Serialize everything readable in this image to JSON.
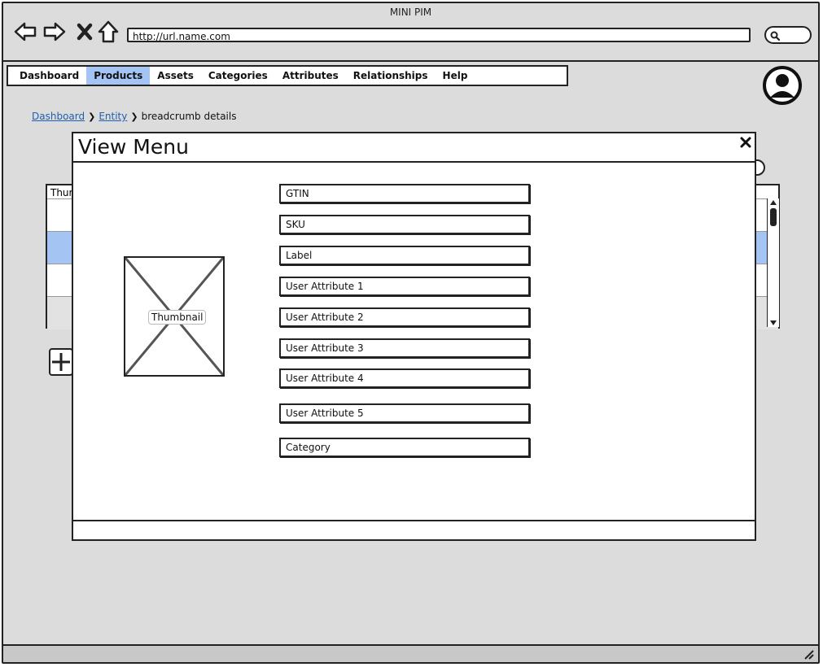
{
  "window": {
    "title": "MINI PIM"
  },
  "toolbar": {
    "url": "http://url.name.com"
  },
  "menu": {
    "items": [
      {
        "label": "Dashboard"
      },
      {
        "label": "Products"
      },
      {
        "label": "Assets"
      },
      {
        "label": "Categories"
      },
      {
        "label": "Attributes"
      },
      {
        "label": "Relationships"
      },
      {
        "label": "Help"
      }
    ],
    "active": "Products"
  },
  "breadcrumb": {
    "items": [
      {
        "label": "Dashboard"
      },
      {
        "label": "Entity"
      },
      {
        "label": "breadcrumb details"
      }
    ]
  },
  "background_table": {
    "header_partial": "Thur"
  },
  "modal": {
    "title": "View Menu",
    "close_icon": "close-icon",
    "thumbnail_label": "Thumbnail",
    "fields": [
      {
        "label": "GTIN"
      },
      {
        "label": "SKU"
      },
      {
        "label": "Label"
      },
      {
        "label": "User Attribute 1"
      },
      {
        "label": "User Attribute 2"
      },
      {
        "label": "User Attribute 3"
      },
      {
        "label": "User Attribute 4"
      },
      {
        "label": "User Attribute 5"
      },
      {
        "label": "Category"
      }
    ]
  },
  "colors": {
    "active_tab": "#a4c4f4",
    "link": "#1f5fb0",
    "background": "#dcdcdc"
  }
}
